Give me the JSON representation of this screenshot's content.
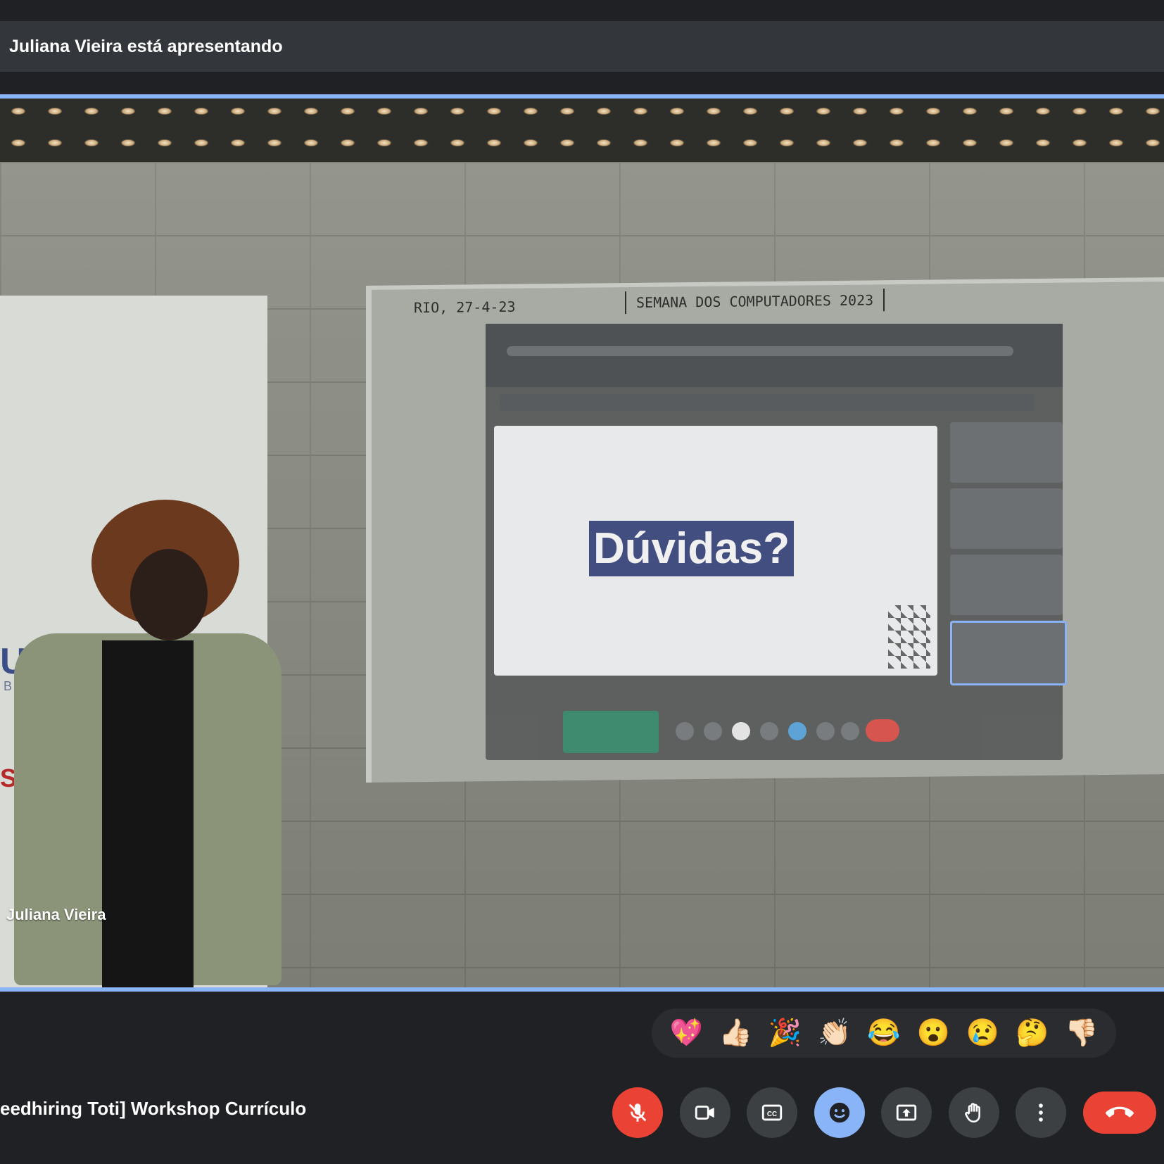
{
  "presenting_bar": {
    "text": "Juliana Vieira está apresentando"
  },
  "video": {
    "participant_name": "Juliana Vieira",
    "banner_logo_1": "UNID",
    "banner_logo_2": "Brasil",
    "banner_logo_3": "SAID",
    "whiteboard_date": "RIO, 27-4-23",
    "whiteboard_title": "SEMANA DOS COMPUTADORES 2023",
    "slide_text": "Dúvidas?"
  },
  "reactions": [
    {
      "name": "sparkling-heart",
      "glyph": "💖"
    },
    {
      "name": "thumbs-up",
      "glyph": "👍🏻"
    },
    {
      "name": "party-popper",
      "glyph": "🎉"
    },
    {
      "name": "clapping-hands",
      "glyph": "👏🏻"
    },
    {
      "name": "tears-of-joy",
      "glyph": "😂"
    },
    {
      "name": "surprised-face",
      "glyph": "😮"
    },
    {
      "name": "sad-face",
      "glyph": "😢"
    },
    {
      "name": "thinking-face",
      "glyph": "🤔"
    },
    {
      "name": "thumbs-down",
      "glyph": "👎🏻"
    }
  ],
  "meeting": {
    "title": "eedhiring Toti] Workshop Currículo"
  },
  "controls": {
    "mic": {
      "icon": "mic-off-icon",
      "state": "muted",
      "color": "#ea4335"
    },
    "camera": {
      "icon": "videocam-icon"
    },
    "captions": {
      "icon": "closed-captions-icon"
    },
    "reactions": {
      "icon": "emoji-icon",
      "state": "active",
      "color": "#8ab4f8"
    },
    "present": {
      "icon": "present-screen-icon"
    },
    "raise_hand": {
      "icon": "hand-icon"
    },
    "more": {
      "icon": "more-vert-icon"
    },
    "leave": {
      "icon": "call-end-icon",
      "color": "#ea4335"
    }
  },
  "colors": {
    "background": "#202124",
    "tile_border": "#8ab4f8",
    "presenting_bar": "#33363a",
    "button_dark": "#3c4043"
  }
}
